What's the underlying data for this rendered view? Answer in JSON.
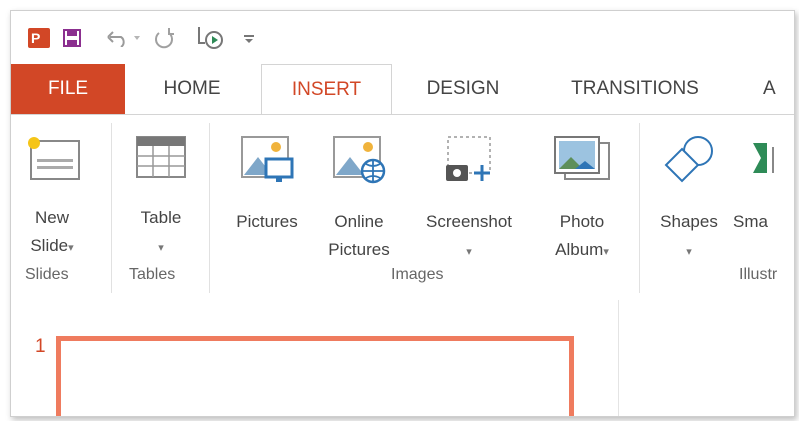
{
  "qat": {
    "app_icon_letter": "P",
    "icons": [
      "powerpoint-logo-icon",
      "save-icon",
      "undo-icon",
      "redo-icon",
      "slideshow-icon",
      "customize-qat-icon"
    ]
  },
  "tabs": {
    "file": "FILE",
    "home": "HOME",
    "insert": "INSERT",
    "design": "DESIGN",
    "transitions": "TRANSITIONS",
    "animations_partial": "A"
  },
  "ribbon": {
    "new_slide": {
      "line1": "New",
      "line2": "Slide"
    },
    "table": {
      "line1": "Table"
    },
    "pictures": {
      "line1": "Pictures"
    },
    "online_pictures": {
      "line1": "Online",
      "line2": "Pictures"
    },
    "screenshot": {
      "line1": "Screenshot"
    },
    "photo_album": {
      "line1": "Photo",
      "line2": "Album"
    },
    "shapes": {
      "line1": "Shapes"
    },
    "smartart_partial": {
      "line1": "Sma"
    },
    "caret": "▾",
    "groups": {
      "slides": "Slides",
      "tables": "Tables",
      "images": "Images",
      "illustrations_partial": "Illustr"
    }
  },
  "workspace": {
    "slide_number": "1"
  },
  "colors": {
    "accent": "#d24726",
    "slide_border": "#ef7b5e",
    "icon_blue": "#2e75b6"
  }
}
